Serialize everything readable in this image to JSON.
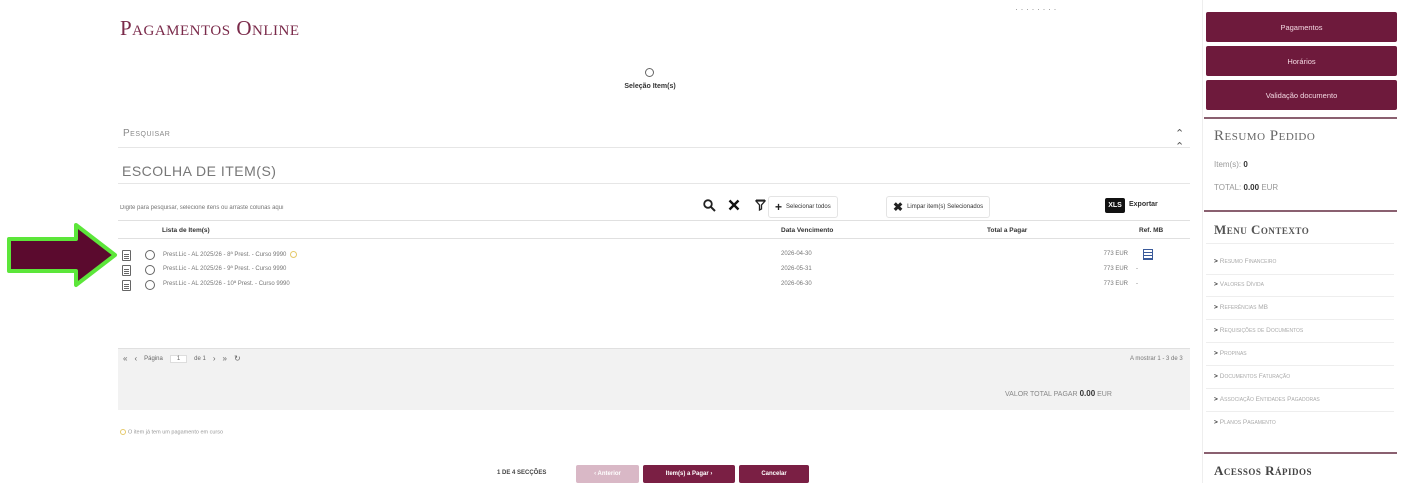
{
  "page": {
    "title": "Pagamentos Online",
    "top_right_text": "· · · · · · · ·"
  },
  "steps": {
    "current_label": "Seleção Item(s)",
    "count_label": "1 DE 4 SECÇÕES"
  },
  "search_section": {
    "label": "Pesquisar"
  },
  "items_section": {
    "title": "ESCOLHA DE ITEM(S)",
    "search_placeholder": "Digite para pesquisar, selecione itens ou arraste colunas aqui",
    "select_all_label": "Selecionar todos",
    "clear_selected_label": "Limpar item(s) Selecionados",
    "export_badge": "XLS",
    "export_label": "Exportar"
  },
  "table": {
    "columns": [
      "Lista de Item(s)",
      "Data Vencimento",
      "Total a Pagar",
      "Ref. MB"
    ],
    "rows": [
      {
        "description": "Prest.Lic - AL 2025/26 - 8ª Prest. - Curso 9990",
        "due_date": "2026-04-30",
        "total": "773 EUR",
        "ref": "",
        "has_warning": true,
        "has_mb": true
      },
      {
        "description": "Prest.Lic - AL 2025/26 - 9ª Prest. - Curso 9990",
        "due_date": "2026-05-31",
        "total": "773 EUR",
        "ref": "-",
        "has_warning": false,
        "has_mb": false
      },
      {
        "description": "Prest.Lic - AL 2025/26 - 10ª Prest. - Curso 9990",
        "due_date": "2026-06-30",
        "total": "773 EUR",
        "ref": "-",
        "has_warning": false,
        "has_mb": false
      }
    ]
  },
  "pager": {
    "first": "«",
    "prev": "‹",
    "page_word": "Página",
    "page_value": "1",
    "of_label": "de 1",
    "next": "›",
    "last": "»",
    "refresh": "↻",
    "info": "A mostrar 1 - 3 de 3"
  },
  "totals": {
    "label": "VALOR TOTAL PAGAR",
    "value": "0.00",
    "currency": "EUR"
  },
  "note": "O item já tem um pagamento em curso",
  "nav_buttons": {
    "previous": "‹ Anterior",
    "next": "Item(s) a Pagar ›",
    "cancel": "Cancelar"
  },
  "sidebar": {
    "buttons": [
      "Pagamentos",
      "Horários",
      "Validação documento"
    ],
    "summary_title": "Resumo Pedido",
    "items_label": "Item(s):",
    "items_value": "0",
    "total_label": "TOTAL:",
    "total_value": "0.00",
    "total_currency": "EUR",
    "context_title": "Menu Contexto",
    "context_items": [
      "Resumo Financeiro",
      "Valores Dívida",
      "Referências MB",
      "Requisições de Documentos",
      "Propinas",
      "Documentos Faturação",
      "Associação Entidades Pagadoras",
      "Planos Pagamento"
    ],
    "quick_access_title": "Acessos Rápidos"
  },
  "colors": {
    "brand": "#7a1f44",
    "title": "#7a2a4a",
    "highlight_arrow": "#5b0a2e",
    "arrow_outline": "#5ce63a"
  }
}
